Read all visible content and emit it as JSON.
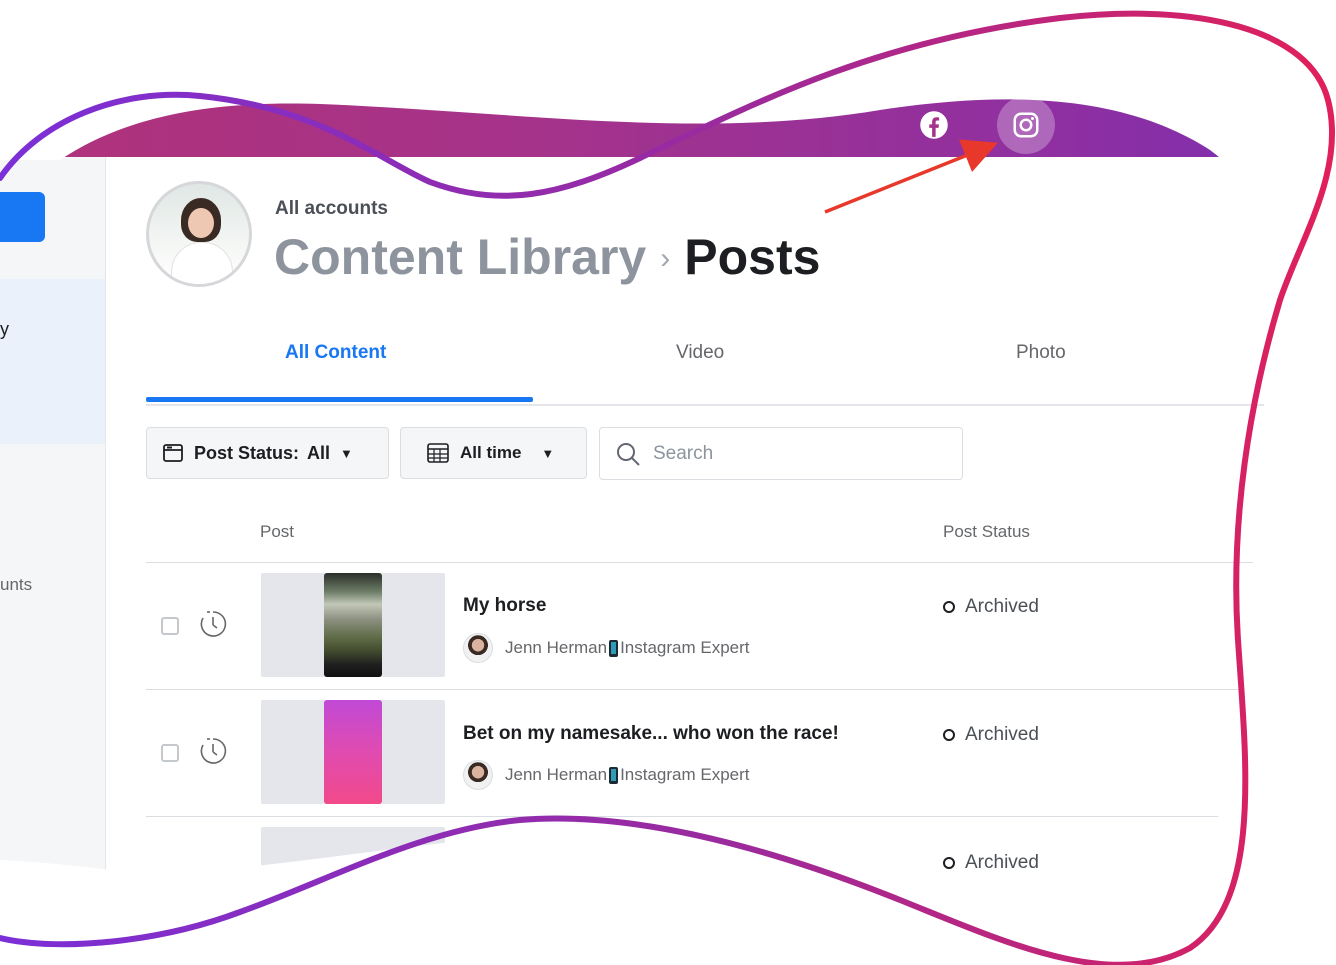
{
  "header": {
    "account_label": "All accounts",
    "breadcrumb_parent": "Content Library",
    "breadcrumb_separator": "›",
    "breadcrumb_current": "Posts",
    "platform_icons": [
      "facebook-icon",
      "instagram-icon"
    ]
  },
  "sidebar": {
    "fragment_1": "y",
    "fragment_2": "unts"
  },
  "tabs": [
    {
      "label": "All Content",
      "active": true
    },
    {
      "label": "Video",
      "active": false
    },
    {
      "label": "Photo",
      "active": false
    }
  ],
  "filters": {
    "post_status_label": "Post Status:",
    "post_status_value": "All",
    "date_range_label": "All time",
    "search_placeholder": "Search"
  },
  "table": {
    "columns": [
      "Post",
      "Post Status"
    ],
    "rows": [
      {
        "title": "My horse",
        "author": "Jenn Herman",
        "role": "Instagram Expert",
        "status": "Archived"
      },
      {
        "title": "Bet on my namesake... who won the race!",
        "author": "Jenn Herman",
        "role": "Instagram Expert",
        "status": "Archived"
      },
      {
        "title": "",
        "author": "",
        "role": "",
        "status": "Archived"
      }
    ]
  },
  "colors": {
    "accent": "#1877f2",
    "header_gradient_start": "#b0327a",
    "header_gradient_end": "#7b2fb0",
    "outline_gradient_start": "#7b2fd6",
    "outline_gradient_end": "#e0205a",
    "arrow": "#e8382b"
  }
}
